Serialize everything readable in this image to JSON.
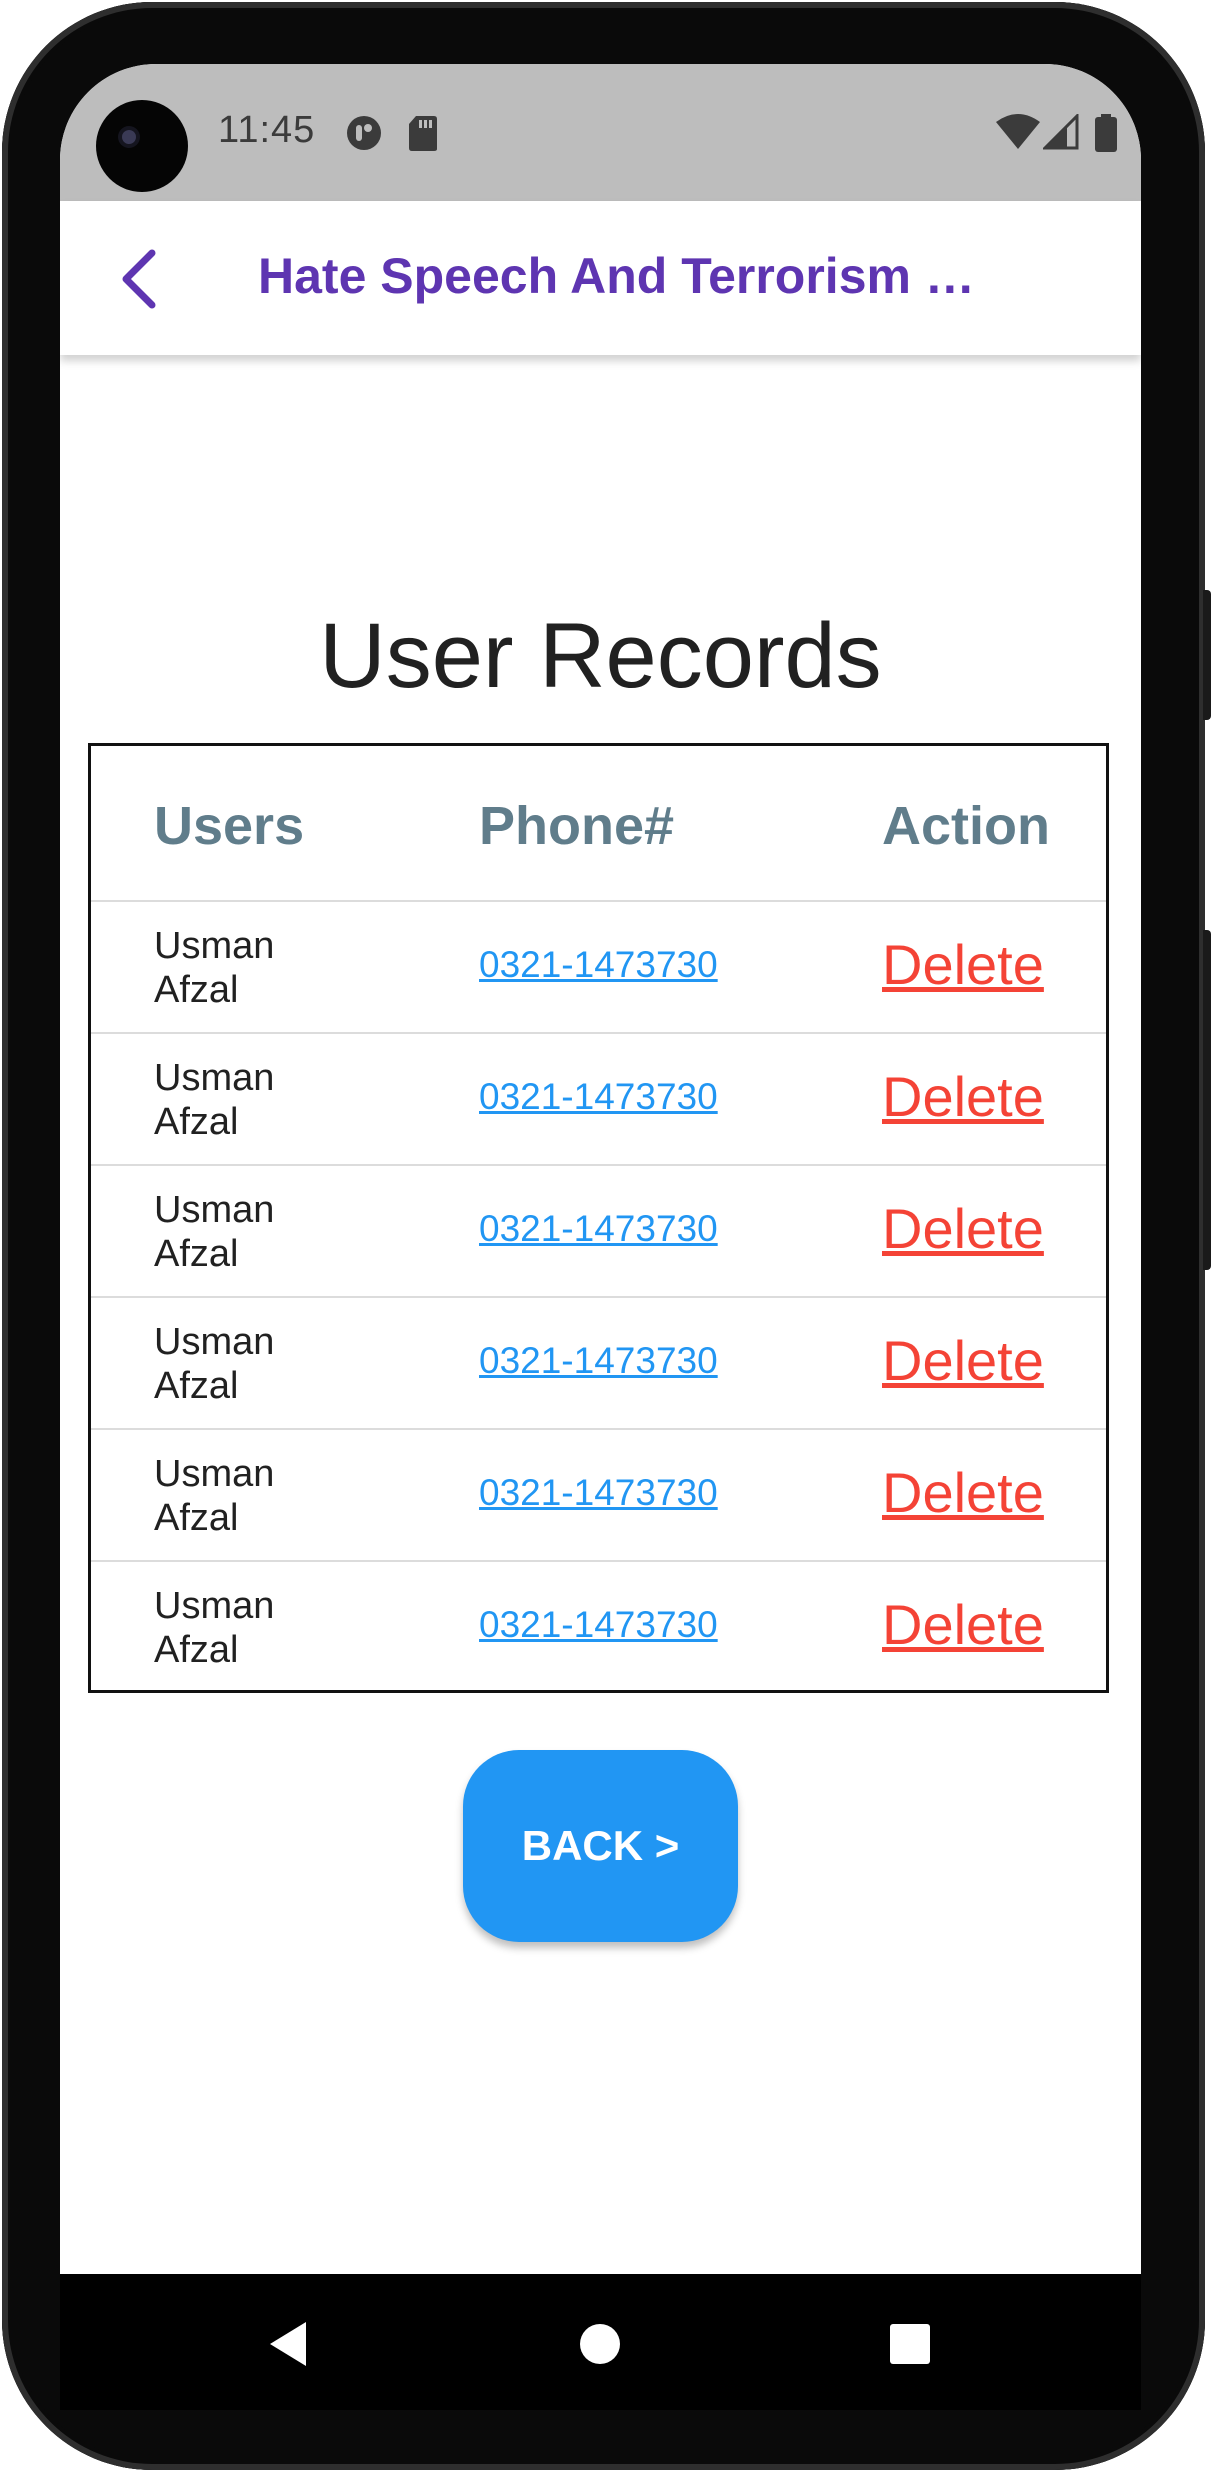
{
  "status_bar": {
    "time": "11:45",
    "icons": [
      "data-saver-icon",
      "sd-card-icon",
      "wifi-icon",
      "signal-icon",
      "battery-icon"
    ]
  },
  "app_bar": {
    "back_icon": "chevron-left-icon",
    "title": "Hate Speech And Terrorism …"
  },
  "page": {
    "title": "User Records"
  },
  "table": {
    "headers": {
      "users": "Users",
      "phone": "Phone#",
      "action": "Action"
    },
    "rows": [
      {
        "user": "Usman Afzal",
        "phone": "0321-1473730",
        "action": "Delete"
      },
      {
        "user": "Usman Afzal",
        "phone": "0321-1473730",
        "action": "Delete"
      },
      {
        "user": "Usman Afzal",
        "phone": "0321-1473730",
        "action": "Delete"
      },
      {
        "user": "Usman Afzal",
        "phone": "0321-1473730",
        "action": "Delete"
      },
      {
        "user": "Usman Afzal",
        "phone": "0321-1473730",
        "action": "Delete"
      },
      {
        "user": "Usman Afzal",
        "phone": "0321-1473730",
        "action": "Delete"
      }
    ]
  },
  "back_button": {
    "label": "BACK >"
  },
  "nav_bar": {
    "icons": [
      "back-triangle-icon",
      "home-circle-icon",
      "recents-square-icon"
    ]
  },
  "colors": {
    "accent": "#5e35b1",
    "header_text": "#607d8b",
    "link": "#2196f3",
    "danger": "#f44336",
    "button": "#2196f3",
    "status_bar": "#bdbdbd"
  }
}
